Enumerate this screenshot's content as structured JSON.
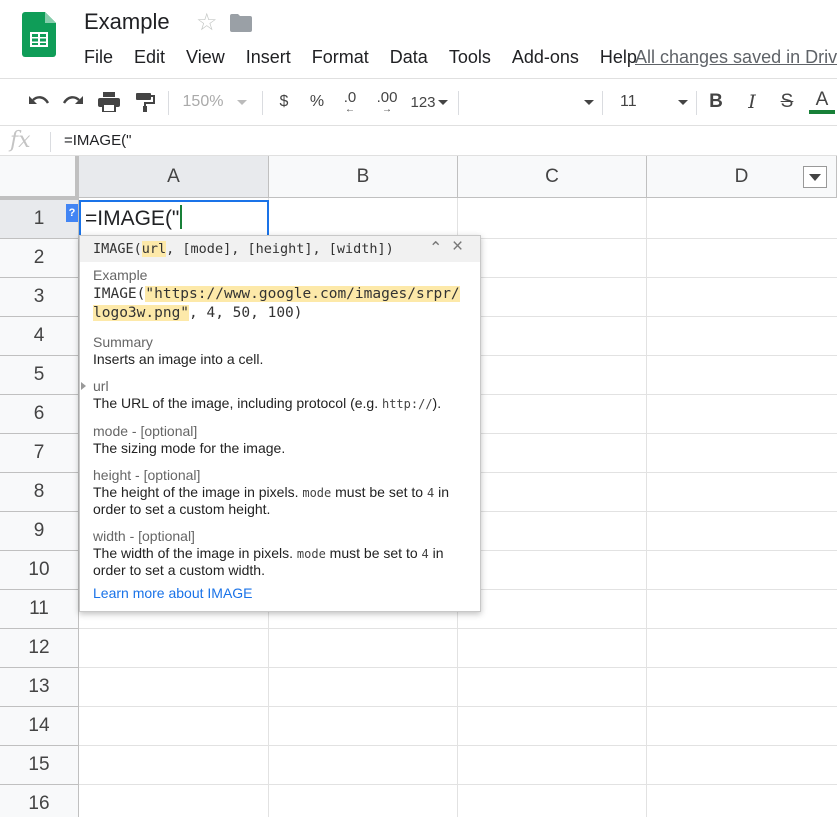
{
  "app": {
    "title": "Example",
    "save_status": "All changes saved in Drive",
    "menu": [
      "File",
      "Edit",
      "View",
      "Insert",
      "Format",
      "Data",
      "Tools",
      "Add-ons",
      "Help"
    ],
    "brand_color": "#0f9d58"
  },
  "toolbar": {
    "zoom": "150%",
    "currency": "$",
    "percent": "%",
    "decrease_decimal": ".0",
    "increase_decimal": ".00",
    "number_format": "123",
    "font_family": "",
    "font_size": "11",
    "bold": "B",
    "italic": "I",
    "strikethrough": "S",
    "text_color": "A",
    "text_color_value": "#188038"
  },
  "formula_bar": {
    "icon": "fx",
    "value": "=IMAGE(\""
  },
  "grid": {
    "columns": [
      "A",
      "B",
      "C",
      "D"
    ],
    "rows": [
      "1",
      "2",
      "3",
      "4",
      "5",
      "6",
      "7",
      "8",
      "9",
      "10",
      "11",
      "12",
      "13",
      "14",
      "15",
      "16"
    ],
    "active_cell": "A1",
    "active_cell_value": "=IMAGE(\""
  },
  "help_popup": {
    "toggle": "?",
    "signature": {
      "fn": "IMAGE(",
      "arg_active": "url",
      "rest": ", [mode], [height], [width])"
    },
    "example_label": "Example",
    "example_prefix": "IMAGE(",
    "example_url_line1": "\"https://www.google.com/images/srpr/",
    "example_url_line2": "logo3w.png\"",
    "example_suffix": ", 4, 50, 100)",
    "summary_label": "Summary",
    "summary_text": "Inserts an image into a cell.",
    "params": [
      {
        "label": "url",
        "text_before": "The URL of the image, including protocol (e.g. ",
        "code": "http://",
        "text_after": ")."
      },
      {
        "label": "mode - [optional]",
        "text": "The sizing mode for the image."
      },
      {
        "label": "height - [optional]",
        "text_before": "The height of the image in pixels. ",
        "code1": "mode",
        "text_mid": " must be set to ",
        "code2": "4",
        "text_after1": " in",
        "text_after2": "order to set a custom height."
      },
      {
        "label": "width - [optional]",
        "text_before": "The width of the image in pixels. ",
        "code1": "mode",
        "text_mid": " must be set to ",
        "code2": "4",
        "text_after1": " in",
        "text_after2": "order to set a custom width."
      }
    ],
    "learn_more": "Learn more about IMAGE"
  }
}
